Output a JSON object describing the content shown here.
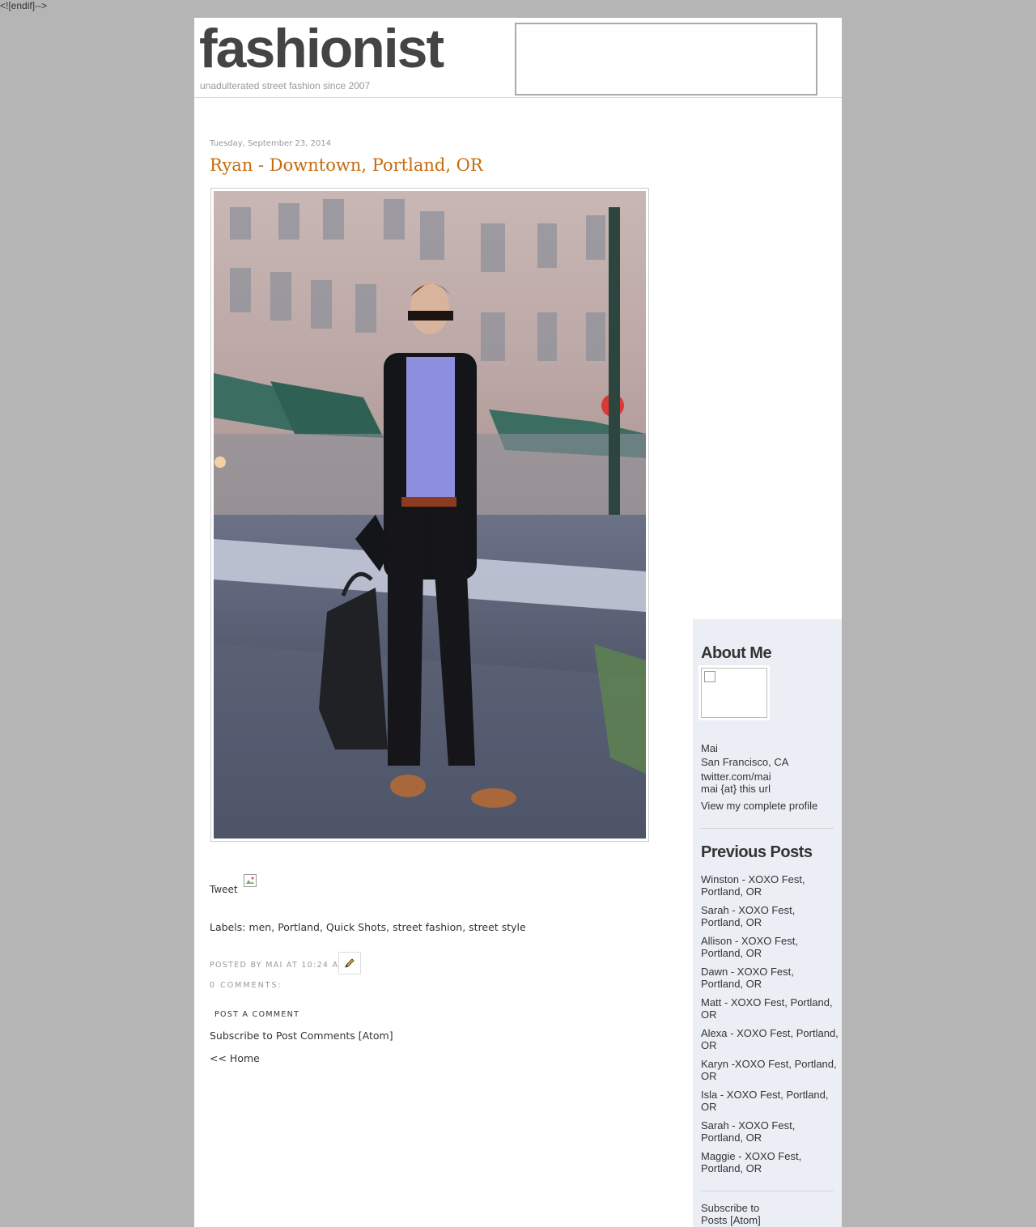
{
  "stray_text": "<![endif]-->",
  "header": {
    "site_title": "fashionist",
    "tagline": "unadulterated street fashion since 2007"
  },
  "post": {
    "date": "Tuesday, September 23, 2014",
    "title": "Ryan - Downtown, Portland, OR",
    "tweet_label": "Tweet",
    "labels_prefix": "Labels:",
    "labels": [
      "men",
      "Portland",
      "Quick Shots",
      "street fashion",
      "street style"
    ],
    "posted_by": "Posted by Mai at 10:24 AM",
    "comments_count": "0 comments:",
    "post_comment_label": "Post a Comment",
    "subscribe_comments": "Subscribe to Post Comments [Atom]",
    "home_link": "<< Home"
  },
  "sidebar": {
    "about_heading": "About Me",
    "name": "Mai",
    "location": "San Francisco, CA",
    "twitter": "twitter.com/mai",
    "email": "mai {at} this url",
    "view_profile": "View my complete profile",
    "previous_heading": "Previous Posts",
    "previous_posts": [
      "Winston - XOXO Fest, Portland, OR",
      "Sarah - XOXO Fest, Portland, OR",
      "Allison - XOXO Fest, Portland, OR",
      "Dawn - XOXO Fest, Portland, OR",
      "Matt - XOXO Fest, Portland, OR",
      "Alexa - XOXO Fest, Portland, OR",
      "Karyn -XOXO Fest, Portland, OR",
      "Isla - XOXO Fest, Portland, OR",
      "Sarah - XOXO Fest, Portland, OR",
      "Maggie - XOXO Fest, Portland, OR"
    ],
    "subscribe_posts": "Subscribe to Posts [Atom]"
  },
  "colors": {
    "background": "#b5b5b5",
    "title_orange": "#c66a0c",
    "sidebar_bg": "#ebeff5"
  }
}
